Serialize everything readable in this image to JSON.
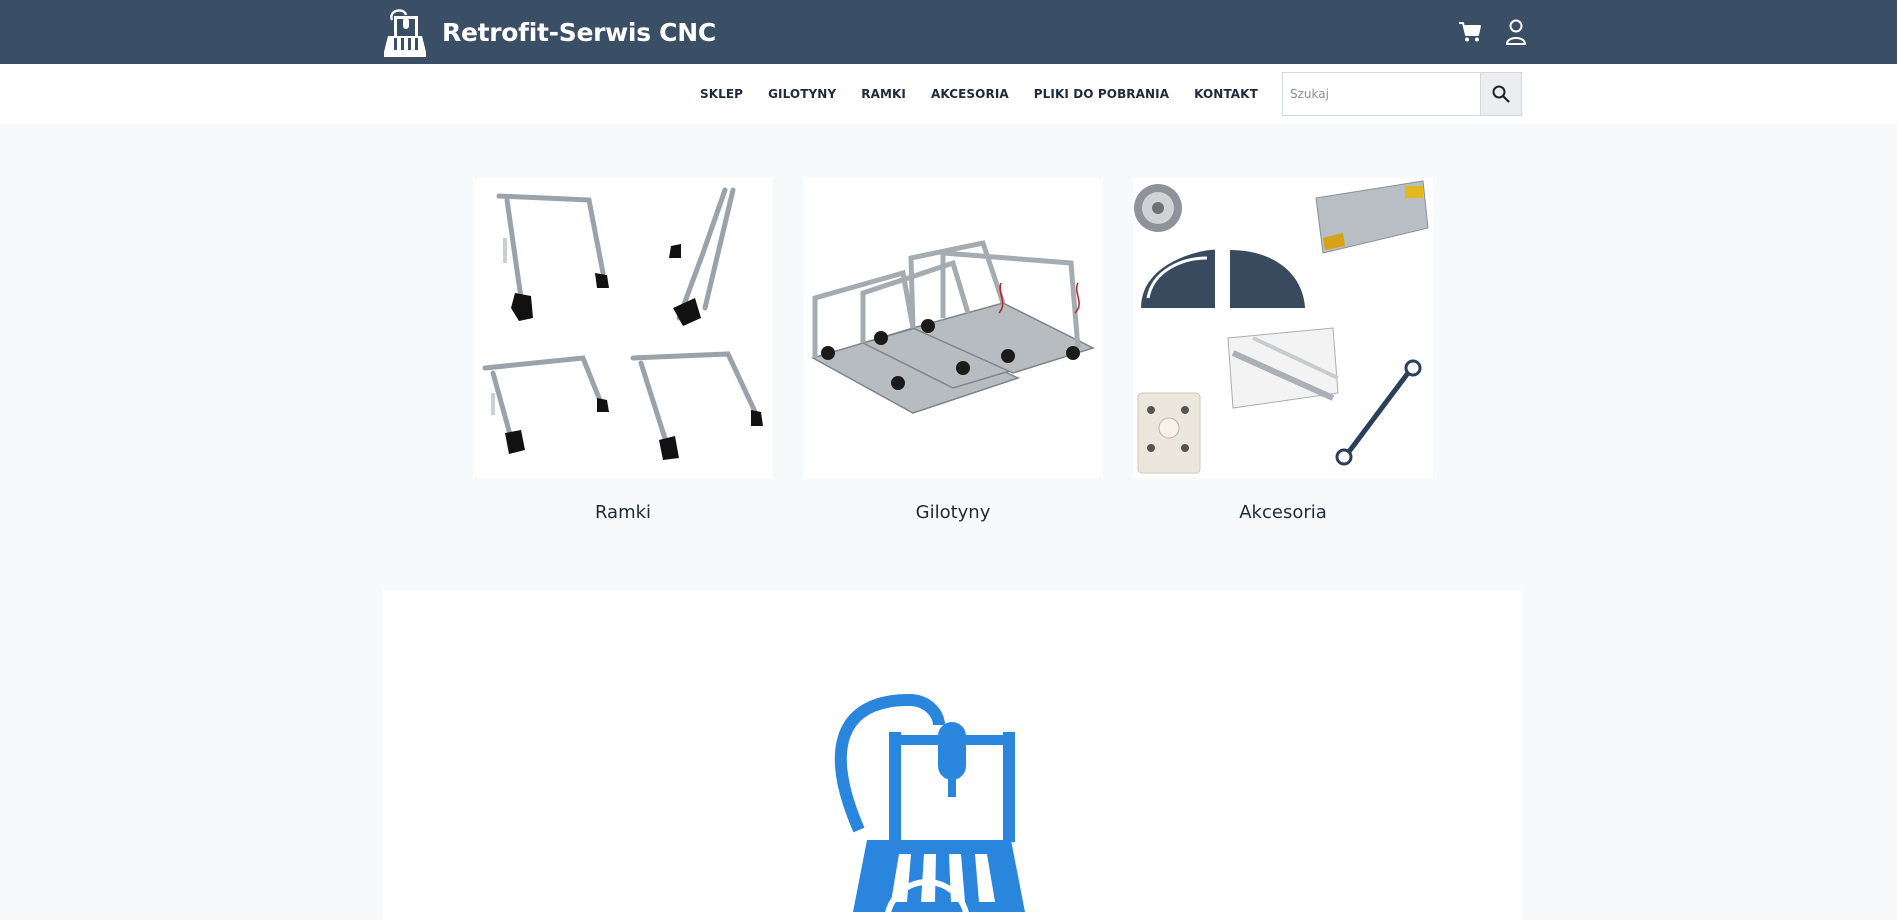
{
  "header": {
    "site_title": "Retrofit-Serwis CNC",
    "icons": [
      "cart-icon",
      "user-icon"
    ]
  },
  "nav": {
    "items": [
      {
        "label": "SKLEP"
      },
      {
        "label": "GILOTYNY"
      },
      {
        "label": "RAMKI"
      },
      {
        "label": "AKCESORIA"
      },
      {
        "label": "PLIKI DO POBRANIA"
      },
      {
        "label": "KONTAKT"
      }
    ]
  },
  "search": {
    "placeholder": "Szukaj",
    "value": ""
  },
  "categories": [
    {
      "label": "Ramki"
    },
    {
      "label": "Gilotyny"
    },
    {
      "label": "Akcesoria"
    }
  ],
  "colors": {
    "header_bg": "#3a4e66",
    "page_bg": "#f7f9fb",
    "accent_blue": "#2a86dd"
  }
}
